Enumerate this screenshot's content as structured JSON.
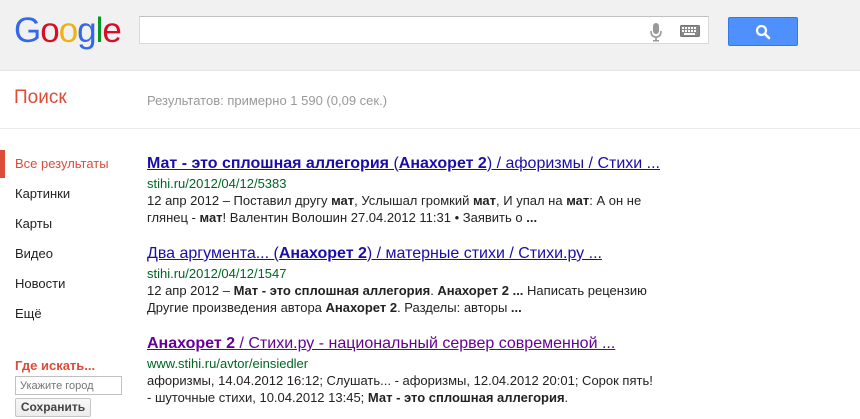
{
  "logo": {
    "letters": [
      "G",
      "o",
      "o",
      "g",
      "l",
      "e"
    ],
    "colors": [
      "#3369e8",
      "#d50f25",
      "#eeb211",
      "#3369e8",
      "#009925",
      "#d50f25"
    ]
  },
  "header": {
    "search_value": "",
    "search_button_icon": "magnifier-icon"
  },
  "subheader": {
    "title": "Поиск",
    "stats": "Результатов: примерно 1 590 (0,09 сек.)"
  },
  "nav": {
    "items": [
      "Все результаты",
      "Картинки",
      "Карты",
      "Видео",
      "Новости",
      "Ещё"
    ],
    "where_label": "Где искать...",
    "city_placeholder": "Укажите город",
    "save_label": "Сохранить"
  },
  "results": [
    {
      "title_parts": [
        "Мат - это сплошная аллегория",
        " (",
        "Анахорет 2",
        ") / афоризмы / Стихи ..."
      ],
      "url": "stihi.ru/2012/04/12/5383",
      "snippet_parts": [
        "12 апр 2012 – Поставил другу ",
        "мат",
        ", Услышал громкий ",
        "мат",
        ", И упал на ",
        "мат",
        ": А он не глянец - ",
        "мат",
        "! Валентин Волошин 27.04.2012 11:31 • Заявить о ",
        "..."
      ]
    },
    {
      "title_parts": [
        "Два аргумента... (",
        "Анахорет 2",
        ") / матерные стихи / Стихи.ру ..."
      ],
      "url": "stihi.ru/2012/04/12/1547",
      "snippet_parts": [
        "12 апр 2012 – ",
        "Мат - это сплошная аллегория",
        ". ",
        "Анахорет 2",
        " ",
        "...",
        " Написать рецензию Другие произведения автора ",
        "Анахорет 2",
        ". Разделы: авторы ",
        "..."
      ]
    },
    {
      "title_parts": [
        "Анахорет 2",
        " / Стихи.ру - национальный сервер современной ..."
      ],
      "url": "www.stihi.ru/avtor/einsiedler",
      "snippet_parts": [
        "афоризмы, 14.04.2012 16:12; Слушать... - афоризмы, 12.04.2012 20:01; Сорок пять! - шуточные стихи, 10.04.2012 13:45; ",
        "Мат - это сплошная аллегория",
        "."
      ]
    }
  ],
  "colors": {
    "accent_red": "#dd4b39",
    "link_blue": "#1a0dab",
    "visited_purple": "#660099",
    "url_green": "#006621",
    "button_blue": "#4d90fe"
  }
}
